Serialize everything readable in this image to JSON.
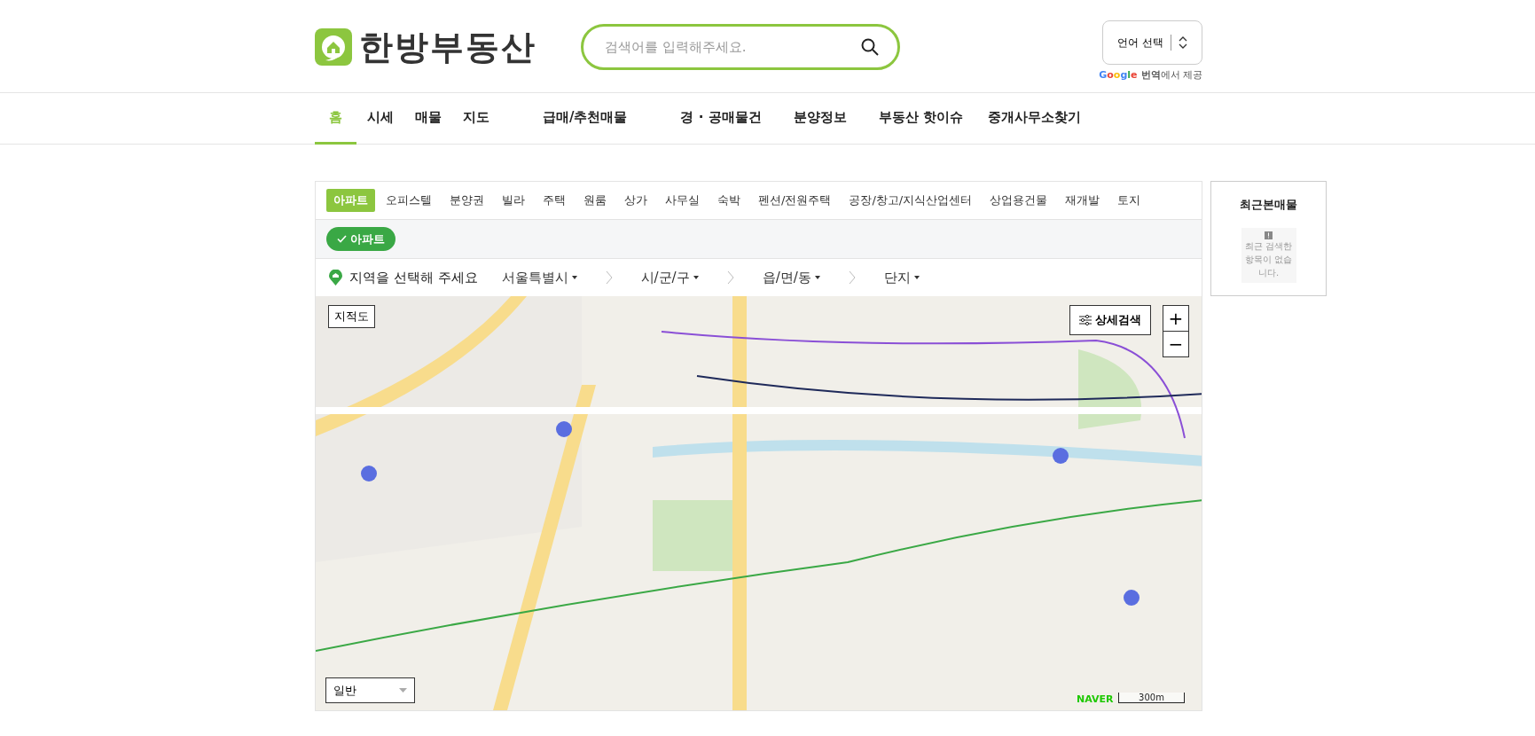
{
  "logo": {
    "text": "한방부동산"
  },
  "search": {
    "placeholder": "검색어를 입력해주세요."
  },
  "language": {
    "label": "언어 선택",
    "credit_brand": "Google",
    "credit": "**번역**에서 제공"
  },
  "nav": [
    {
      "label": "홈",
      "selected": true
    },
    {
      "label": "시세",
      "selected": false
    },
    {
      "label": "매물",
      "selected": false
    },
    {
      "label": "지도",
      "selected": false
    },
    {
      "label": "급매/추천매물",
      "selected": false
    },
    {
      "label": "경 · 공매물건",
      "selected": false
    },
    {
      "label": "분양정보",
      "selected": false
    },
    {
      "label": "부동산 핫이슈",
      "selected": false
    },
    {
      "label": "중개사무소찾기",
      "selected": false
    }
  ],
  "categories": [
    {
      "label": "아파트",
      "selected": true
    },
    {
      "label": "오피스텔",
      "selected": false
    },
    {
      "label": "분양권",
      "selected": false
    },
    {
      "label": "빌라",
      "selected": false
    },
    {
      "label": "주택",
      "selected": false
    },
    {
      "label": "원룸",
      "selected": false
    },
    {
      "label": "상가",
      "selected": false
    },
    {
      "label": "사무실",
      "selected": false
    },
    {
      "label": "숙박",
      "selected": false
    },
    {
      "label": "펜션/전원주택",
      "selected": false
    },
    {
      "label": "공장/창고/지식산업센터",
      "selected": false
    },
    {
      "label": "상업용건물",
      "selected": false
    },
    {
      "label": "재개발",
      "selected": false
    },
    {
      "label": "토지",
      "selected": false
    }
  ],
  "filter_chips": [
    {
      "label": "아파트",
      "checked": true
    }
  ],
  "region": {
    "prompt": "지역을 선택해 주세요",
    "selects": [
      "서울특별시",
      "시/군/구",
      "읍/면/동",
      "단지"
    ]
  },
  "map": {
    "kind": "picture",
    "cadastral_button": "지적도",
    "detail_search": "상세검색",
    "zoom_in": "+",
    "zoom_out": "−",
    "map_type": "일반",
    "brand": "NAVER",
    "scale": "300m"
  },
  "recent": {
    "title": "최근본매물",
    "empty_text": "최근 검색한 항목이 없습니다."
  }
}
